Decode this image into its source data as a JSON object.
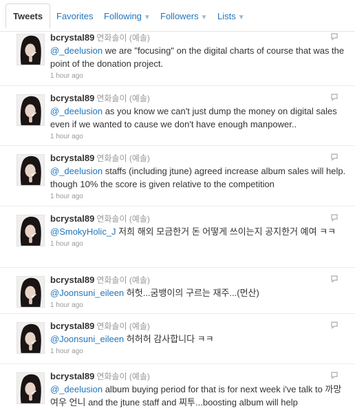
{
  "tabs": [
    {
      "label": "Tweets",
      "active": true,
      "caret": false
    },
    {
      "label": "Favorites",
      "active": false,
      "caret": false
    },
    {
      "label": "Following",
      "active": false,
      "caret": true
    },
    {
      "label": "Followers",
      "active": false,
      "caret": true
    },
    {
      "label": "Lists",
      "active": false,
      "caret": true
    }
  ],
  "icons": {
    "caret": "chevron-down-icon",
    "reply": "reply-icon",
    "avatar": "profile-photo"
  },
  "colors": {
    "link": "#2276bb",
    "text": "#333333",
    "meta": "#999999"
  },
  "tweets": [
    {
      "screen_name": "bcrystal89",
      "full_name": "연화솔이 (예솔)",
      "mention": "@_deelusion",
      "text": " we are \"focusing\" on the digital charts of course that was the point of the donation project.",
      "time": "1 hour ago"
    },
    {
      "screen_name": "bcrystal89",
      "full_name": "연화솔이 (예솔)",
      "mention": "@_deelusion",
      "text": " as you know we can't just dump the money on digital sales even if we wanted to cause we don't have enough manpower..",
      "time": "1 hour ago"
    },
    {
      "screen_name": "bcrystal89",
      "full_name": "연화솔이 (예솔)",
      "mention": "@_deelusion",
      "text": " staffs (including jtune) agreed increase album sales will help. though 10% the score is given relative to the competition",
      "time": "1 hour ago"
    },
    {
      "screen_name": "bcrystal89",
      "full_name": "연화솔이 (예솔)",
      "mention": "@SmokyHolic_J",
      "text": " 저희 해외 모금한거 돈 어떻게 쓰이는지 공지한거 예여 ㅋㅋ",
      "time": "1 hour ago"
    },
    {
      "screen_name": "bcrystal89",
      "full_name": "연화솔이 (예솔)",
      "mention": "@Joonsuni_eileen",
      "text": " 허헛...굼뱅이의 구르는 재주...(먼산)",
      "time": "1 hour ago"
    },
    {
      "screen_name": "bcrystal89",
      "full_name": "연화솔이 (예솔)",
      "mention": "@Joonsuni_eileen",
      "text": " 허허허 감사합니다 ㅋㅋ",
      "time": "1 hour ago"
    },
    {
      "screen_name": "bcrystal89",
      "full_name": "연화솔이 (예솔)",
      "mention": "@_deelusion",
      "text": " album buying period for that is for next week i've talk to 까망여우 언니 and the jtune staff and 찌투...boosting album will help",
      "time": ""
    }
  ]
}
